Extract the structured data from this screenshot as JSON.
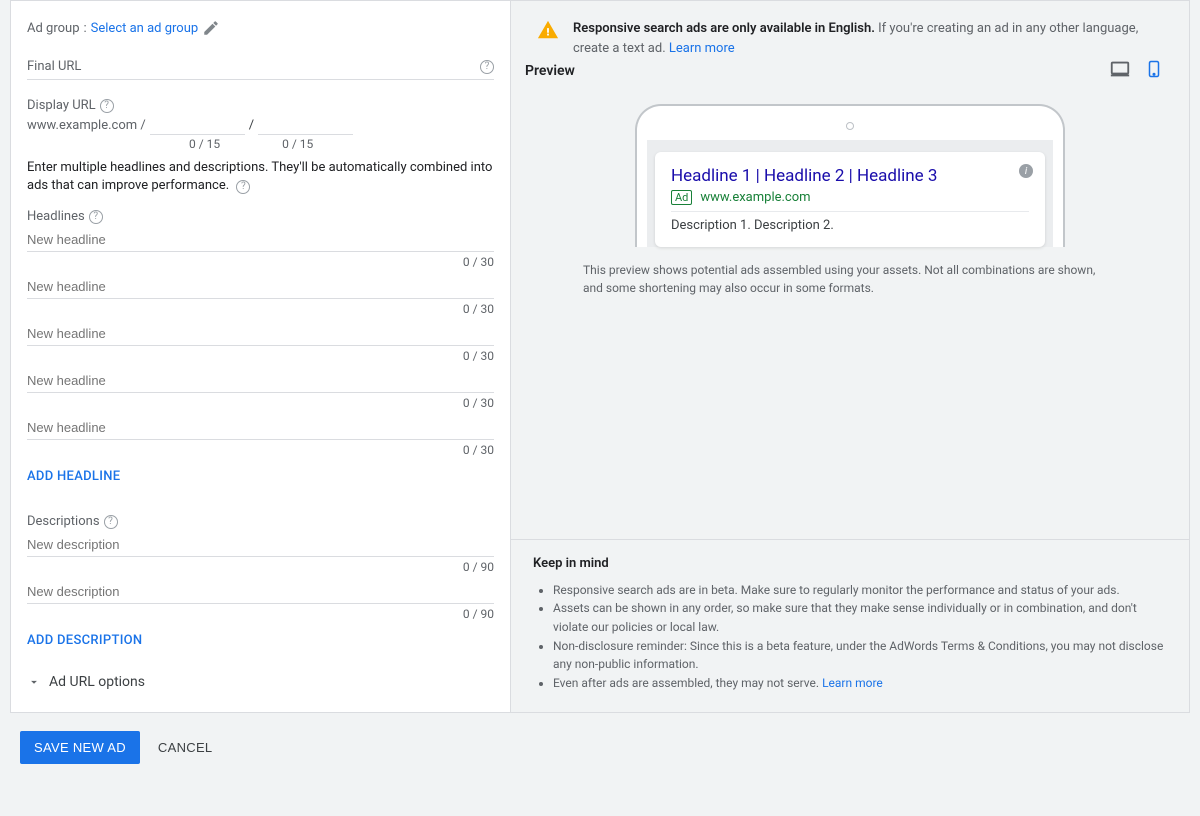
{
  "left": {
    "ad_group_label": "Ad group",
    "ad_group_link": "Select an ad group",
    "final_url_label": "Final URL",
    "display_url_label": "Display URL",
    "display_url_domain": "www.example.com /",
    "path_sep": "/",
    "path_counter": "0 / 15",
    "instruction": "Enter multiple headlines and descriptions. They'll be automatically combined into ads that can improve performance.",
    "headlines_label": "Headlines",
    "headline_placeholder": "New headline",
    "headline_count": "0 / 30",
    "add_headline": "ADD HEADLINE",
    "descriptions_label": "Descriptions",
    "description_placeholder": "New description",
    "description_count": "0 / 90",
    "add_description": "ADD DESCRIPTION",
    "url_options": "Ad URL options"
  },
  "alert": {
    "bold": "Responsive search ads are only available in English.",
    "rest": " If you're creating an ad in any other language, create a text ad. ",
    "link": "Learn more"
  },
  "preview": {
    "title": "Preview",
    "headline": "Headline 1 | Headline 2 | Headline 3",
    "badge": "Ad",
    "url": "www.example.com",
    "desc": "Description 1. Description 2.",
    "footnote": "This preview shows potential ads assembled using your assets. Not all combinations are shown, and some shortening may also occur in some formats."
  },
  "keep": {
    "title": "Keep in mind",
    "items": [
      "Responsive search ads are in beta. Make sure to regularly monitor the performance and status of your ads.",
      "Assets can be shown in any order, so make sure that they make sense individually or in combination, and don't violate our policies or local law.",
      "Non-disclosure reminder: Since this is a beta feature, under the AdWords Terms & Conditions, you may not disclose any non-public information.",
      "Even after ads are assembled, they may not serve. "
    ],
    "learn_more": "Learn more"
  },
  "footer": {
    "save": "SAVE NEW AD",
    "cancel": "CANCEL"
  }
}
